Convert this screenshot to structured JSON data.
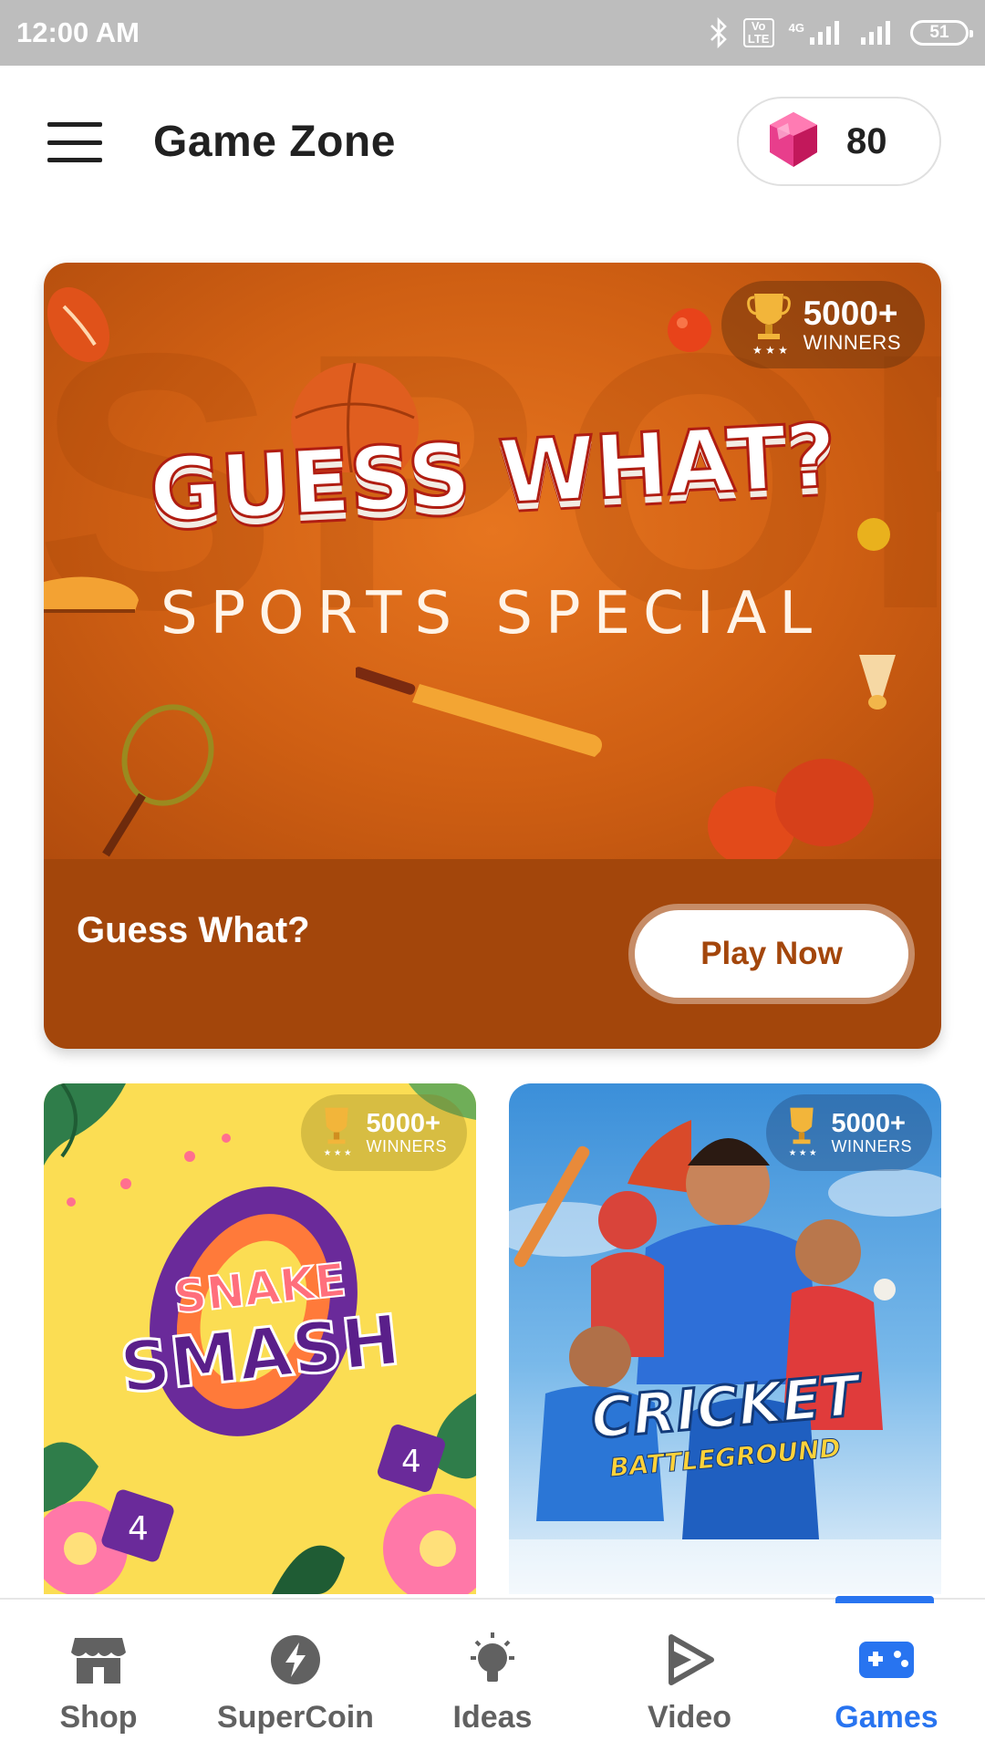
{
  "status_bar": {
    "time": "12:00 AM",
    "network_label": "4G",
    "volte_label": "Vo LTE",
    "battery": "51"
  },
  "app_bar": {
    "title": "Game Zone",
    "coin_count": "80",
    "coin_icon": "pink-gem-icon"
  },
  "featured": {
    "art_title": "GUESS WHAT?",
    "art_subtitle": "SPORTS SPECIAL",
    "winners_count": "5000+",
    "winners_label": "WINNERS",
    "name": "Guess What?",
    "play_label": "Play Now",
    "accent_color": "#a3460b"
  },
  "games": [
    {
      "logo_line1": "SNAKE",
      "logo_line2": "SMASH",
      "winners_count": "5000+",
      "winners_label": "WINNERS",
      "bg_color": "#fbdd53"
    },
    {
      "logo_line1": "CRICKET",
      "logo_line2": "BATTLEGROUND",
      "winners_count": "5000+",
      "winners_label": "WINNERS",
      "bg_color": "#3b8fd9"
    }
  ],
  "bottom_nav": {
    "items": [
      {
        "label": "Shop",
        "icon": "store-icon"
      },
      {
        "label": "SuperCoin",
        "icon": "lightning-icon"
      },
      {
        "label": "Ideas",
        "icon": "lightbulb-icon"
      },
      {
        "label": "Video",
        "icon": "play-icon"
      },
      {
        "label": "Games",
        "icon": "gamepad-icon",
        "active": true
      }
    ],
    "active_color": "#2874f0",
    "inactive_color": "#616161"
  }
}
